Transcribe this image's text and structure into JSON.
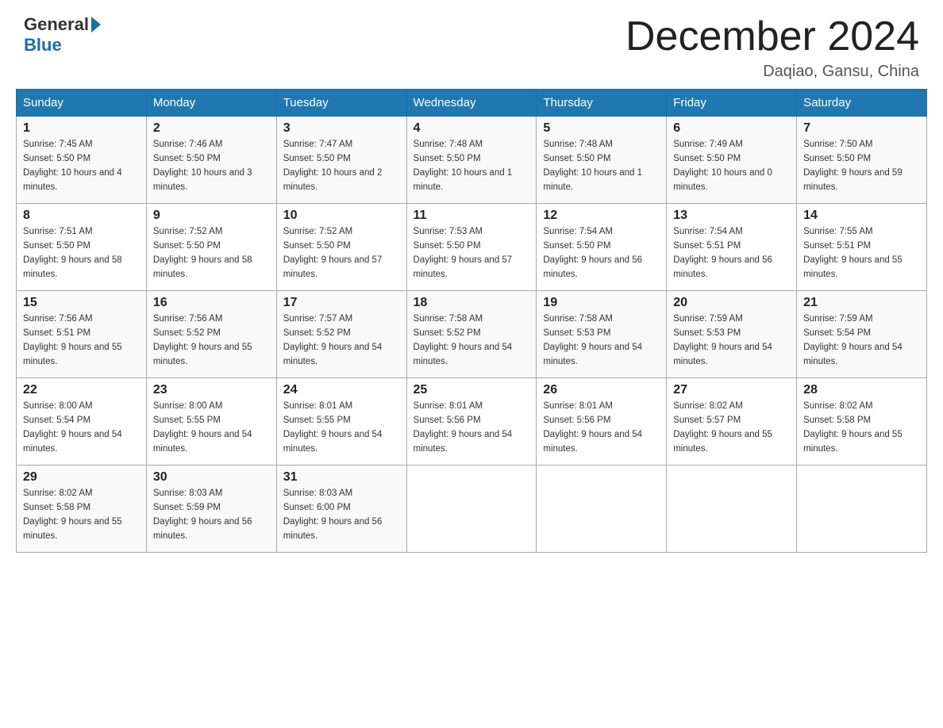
{
  "header": {
    "logo_general": "General",
    "logo_blue": "Blue",
    "month_title": "December 2024",
    "subtitle": "Daqiao, Gansu, China"
  },
  "calendar": {
    "days_of_week": [
      "Sunday",
      "Monday",
      "Tuesday",
      "Wednesday",
      "Thursday",
      "Friday",
      "Saturday"
    ],
    "weeks": [
      [
        {
          "day": "1",
          "sunrise": "7:45 AM",
          "sunset": "5:50 PM",
          "daylight": "10 hours and 4 minutes."
        },
        {
          "day": "2",
          "sunrise": "7:46 AM",
          "sunset": "5:50 PM",
          "daylight": "10 hours and 3 minutes."
        },
        {
          "day": "3",
          "sunrise": "7:47 AM",
          "sunset": "5:50 PM",
          "daylight": "10 hours and 2 minutes."
        },
        {
          "day": "4",
          "sunrise": "7:48 AM",
          "sunset": "5:50 PM",
          "daylight": "10 hours and 1 minute."
        },
        {
          "day": "5",
          "sunrise": "7:48 AM",
          "sunset": "5:50 PM",
          "daylight": "10 hours and 1 minute."
        },
        {
          "day": "6",
          "sunrise": "7:49 AM",
          "sunset": "5:50 PM",
          "daylight": "10 hours and 0 minutes."
        },
        {
          "day": "7",
          "sunrise": "7:50 AM",
          "sunset": "5:50 PM",
          "daylight": "9 hours and 59 minutes."
        }
      ],
      [
        {
          "day": "8",
          "sunrise": "7:51 AM",
          "sunset": "5:50 PM",
          "daylight": "9 hours and 58 minutes."
        },
        {
          "day": "9",
          "sunrise": "7:52 AM",
          "sunset": "5:50 PM",
          "daylight": "9 hours and 58 minutes."
        },
        {
          "day": "10",
          "sunrise": "7:52 AM",
          "sunset": "5:50 PM",
          "daylight": "9 hours and 57 minutes."
        },
        {
          "day": "11",
          "sunrise": "7:53 AM",
          "sunset": "5:50 PM",
          "daylight": "9 hours and 57 minutes."
        },
        {
          "day": "12",
          "sunrise": "7:54 AM",
          "sunset": "5:50 PM",
          "daylight": "9 hours and 56 minutes."
        },
        {
          "day": "13",
          "sunrise": "7:54 AM",
          "sunset": "5:51 PM",
          "daylight": "9 hours and 56 minutes."
        },
        {
          "day": "14",
          "sunrise": "7:55 AM",
          "sunset": "5:51 PM",
          "daylight": "9 hours and 55 minutes."
        }
      ],
      [
        {
          "day": "15",
          "sunrise": "7:56 AM",
          "sunset": "5:51 PM",
          "daylight": "9 hours and 55 minutes."
        },
        {
          "day": "16",
          "sunrise": "7:56 AM",
          "sunset": "5:52 PM",
          "daylight": "9 hours and 55 minutes."
        },
        {
          "day": "17",
          "sunrise": "7:57 AM",
          "sunset": "5:52 PM",
          "daylight": "9 hours and 54 minutes."
        },
        {
          "day": "18",
          "sunrise": "7:58 AM",
          "sunset": "5:52 PM",
          "daylight": "9 hours and 54 minutes."
        },
        {
          "day": "19",
          "sunrise": "7:58 AM",
          "sunset": "5:53 PM",
          "daylight": "9 hours and 54 minutes."
        },
        {
          "day": "20",
          "sunrise": "7:59 AM",
          "sunset": "5:53 PM",
          "daylight": "9 hours and 54 minutes."
        },
        {
          "day": "21",
          "sunrise": "7:59 AM",
          "sunset": "5:54 PM",
          "daylight": "9 hours and 54 minutes."
        }
      ],
      [
        {
          "day": "22",
          "sunrise": "8:00 AM",
          "sunset": "5:54 PM",
          "daylight": "9 hours and 54 minutes."
        },
        {
          "day": "23",
          "sunrise": "8:00 AM",
          "sunset": "5:55 PM",
          "daylight": "9 hours and 54 minutes."
        },
        {
          "day": "24",
          "sunrise": "8:01 AM",
          "sunset": "5:55 PM",
          "daylight": "9 hours and 54 minutes."
        },
        {
          "day": "25",
          "sunrise": "8:01 AM",
          "sunset": "5:56 PM",
          "daylight": "9 hours and 54 minutes."
        },
        {
          "day": "26",
          "sunrise": "8:01 AM",
          "sunset": "5:56 PM",
          "daylight": "9 hours and 54 minutes."
        },
        {
          "day": "27",
          "sunrise": "8:02 AM",
          "sunset": "5:57 PM",
          "daylight": "9 hours and 55 minutes."
        },
        {
          "day": "28",
          "sunrise": "8:02 AM",
          "sunset": "5:58 PM",
          "daylight": "9 hours and 55 minutes."
        }
      ],
      [
        {
          "day": "29",
          "sunrise": "8:02 AM",
          "sunset": "5:58 PM",
          "daylight": "9 hours and 55 minutes."
        },
        {
          "day": "30",
          "sunrise": "8:03 AM",
          "sunset": "5:59 PM",
          "daylight": "9 hours and 56 minutes."
        },
        {
          "day": "31",
          "sunrise": "8:03 AM",
          "sunset": "6:00 PM",
          "daylight": "9 hours and 56 minutes."
        },
        null,
        null,
        null,
        null
      ]
    ]
  }
}
